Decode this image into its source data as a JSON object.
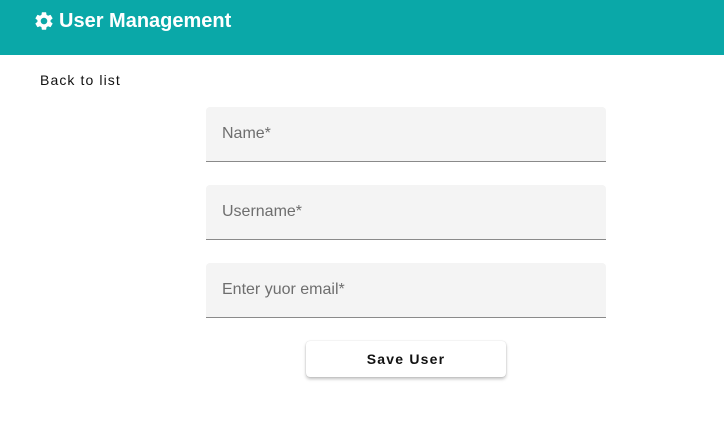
{
  "header": {
    "icon": "gear-icon",
    "title": "User Management",
    "background_color": "#0aa8a8"
  },
  "nav": {
    "back_label": "Back to list"
  },
  "form": {
    "name_placeholder": "Name*",
    "username_placeholder": "Username*",
    "email_placeholder": "Enter yuor email*",
    "name_value": "",
    "username_value": "",
    "email_value": "",
    "save_label": "Save User"
  }
}
